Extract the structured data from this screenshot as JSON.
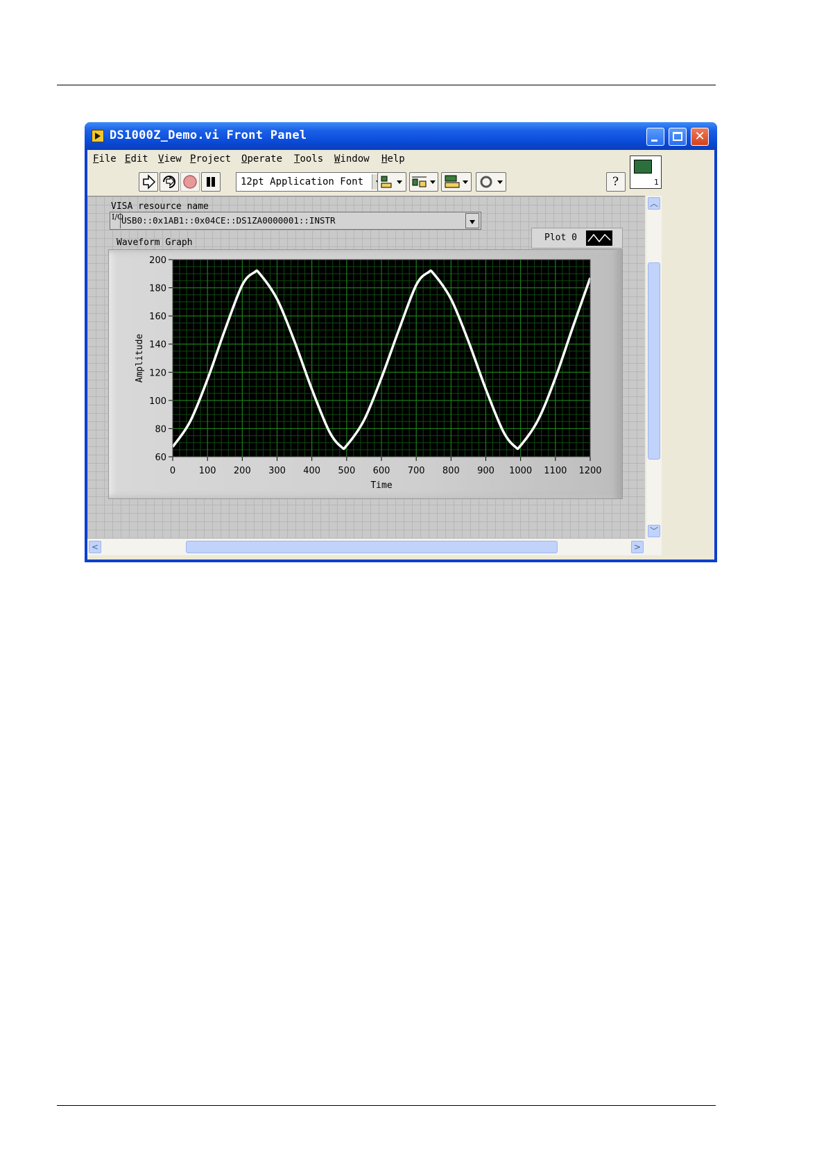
{
  "window": {
    "title": "DS1000Z_Demo.vi Front Panel"
  },
  "menu": [
    "File",
    "Edit",
    "View",
    "Project",
    "Operate",
    "Tools",
    "Window",
    "Help"
  ],
  "toolbar": {
    "font_label": "12pt Application Font",
    "help_glyph": "?"
  },
  "vi_icon": {
    "number": "1"
  },
  "visa": {
    "label": "VISA resource name",
    "io_glyph": "I/O",
    "value": "USB0::0x1AB1::0x04CE::DS1ZA0000001::INSTR"
  },
  "graph": {
    "label": "Waveform Graph",
    "legend": "Plot 0"
  },
  "colors": {
    "plot_background": "#000000",
    "grid_major": "#1f8a1f",
    "grid_minor": "#0e4a0e",
    "trace": "#ffffff",
    "titlebar": "#0a4bd8"
  },
  "chart_data": {
    "type": "line",
    "title": "",
    "xlabel": "Time",
    "ylabel": "Amplitude",
    "xlim": [
      0,
      1200
    ],
    "ylim": [
      60,
      200
    ],
    "x_ticks": [
      "0",
      "100",
      "200",
      "300",
      "400",
      "500",
      "600",
      "700",
      "800",
      "900",
      "1000",
      "1100",
      "1200"
    ],
    "y_ticks": [
      "60",
      "80",
      "100",
      "120",
      "140",
      "160",
      "180",
      "200"
    ],
    "grid": true,
    "series": [
      {
        "name": "Plot 0",
        "x": [
          0,
          50,
          100,
          150,
          200,
          235,
          250,
          300,
          350,
          400,
          450,
          485,
          500,
          550,
          600,
          650,
          700,
          735,
          750,
          800,
          850,
          900,
          950,
          985,
          1000,
          1050,
          1100,
          1150,
          1200
        ],
        "y": [
          67,
          85,
          115,
          150,
          182,
          191,
          190,
          172,
          142,
          108,
          78,
          67,
          68,
          86,
          116,
          150,
          182,
          191,
          190,
          172,
          142,
          108,
          78,
          67,
          68,
          86,
          116,
          152,
          187
        ]
      }
    ]
  }
}
